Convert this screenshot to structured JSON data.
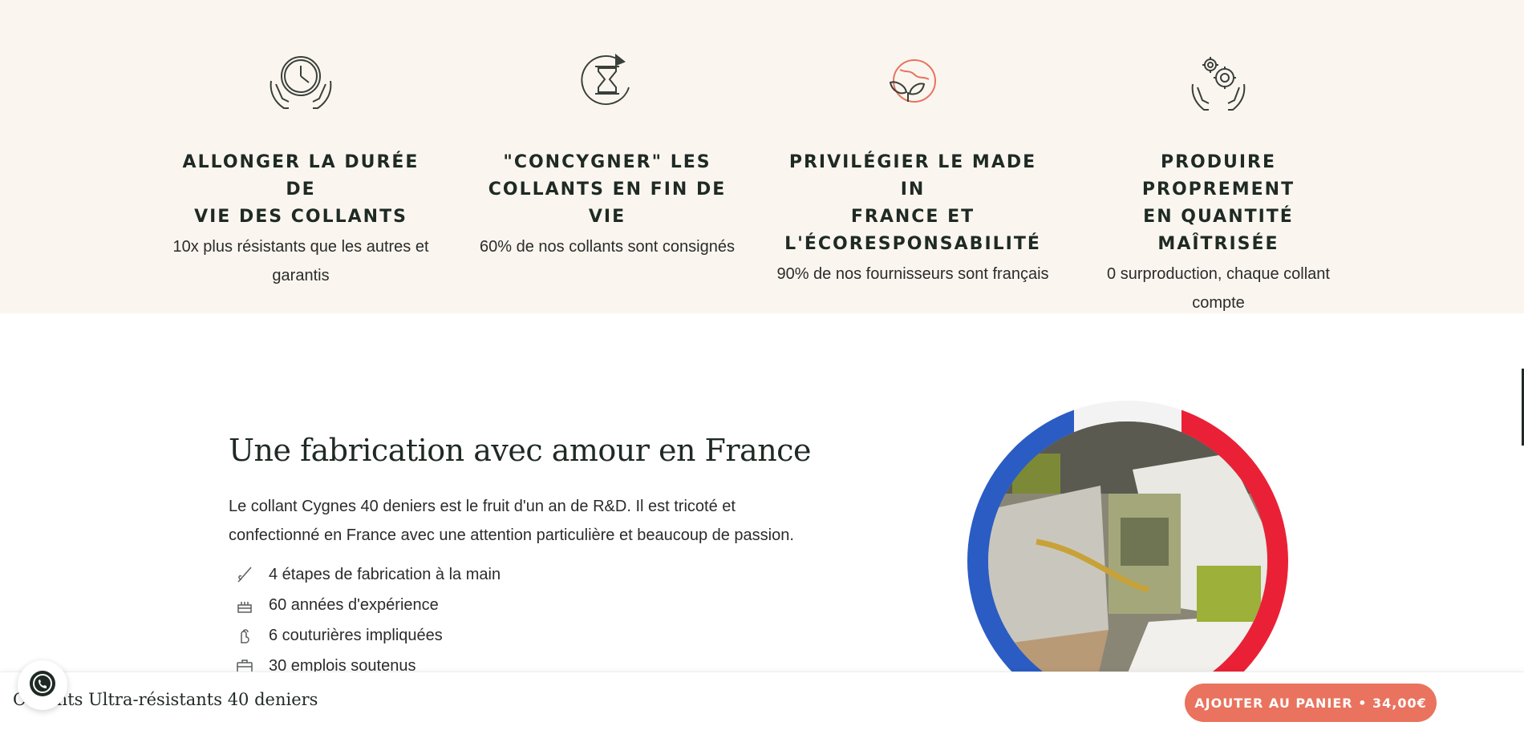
{
  "values": {
    "columns": [
      {
        "title_line1": "ALLONGER LA DURÉE DE",
        "title_line2": "VIE DES COLLANTS",
        "title_line3": "",
        "desc": "10x plus résistants que les autres et garantis",
        "icon": "clock-hands-icon"
      },
      {
        "title_line1": "\"CONCYGNER\" LES",
        "title_line2": "COLLANTS EN FIN DE VIE",
        "title_line3": "",
        "desc": "60% de nos collants sont consignés",
        "icon": "hourglass-cycle-icon"
      },
      {
        "title_line1": "PRIVILÉGIER LE MADE IN",
        "title_line2": "FRANCE ET",
        "title_line3": "L'ÉCORESPONSABILITÉ",
        "desc": "90% de nos fournisseurs sont français",
        "icon": "globe-leaf-icon"
      },
      {
        "title_line1": "PRODUIRE PROPREMENT",
        "title_line2": "EN QUANTITÉ MAÎTRISÉE",
        "title_line3": "",
        "desc": "0 surproduction, chaque collant compte",
        "icon": "gears-hands-icon"
      }
    ]
  },
  "fabrication": {
    "title": "Une fabrication avec amour en France",
    "text": "Le collant Cygnes 40 deniers est le fruit d'un an de R&D. Il est tricoté et confectionné en France avec une attention particulière et beaucoup de passion.",
    "features": [
      {
        "label": "4 étapes de fabrication à la main",
        "icon": "needle-icon"
      },
      {
        "label": "60 années d'expérience",
        "icon": "cake-icon"
      },
      {
        "label": "6 couturières impliquées",
        "icon": "hand-icon"
      },
      {
        "label": "30 emplois soutenus",
        "icon": "briefcase-icon"
      }
    ],
    "flag_colors": [
      "#2a5cc4",
      "#f3f3f3",
      "#ea2136"
    ]
  },
  "sticky": {
    "title": "Collants Ultra-résistants 40 deniers",
    "cart_label": "AJOUTER AU PANIER • 34,00€"
  },
  "colors": {
    "cream": "#faf6ef",
    "accent": "#e9735e",
    "ink": "#1f2a24"
  }
}
